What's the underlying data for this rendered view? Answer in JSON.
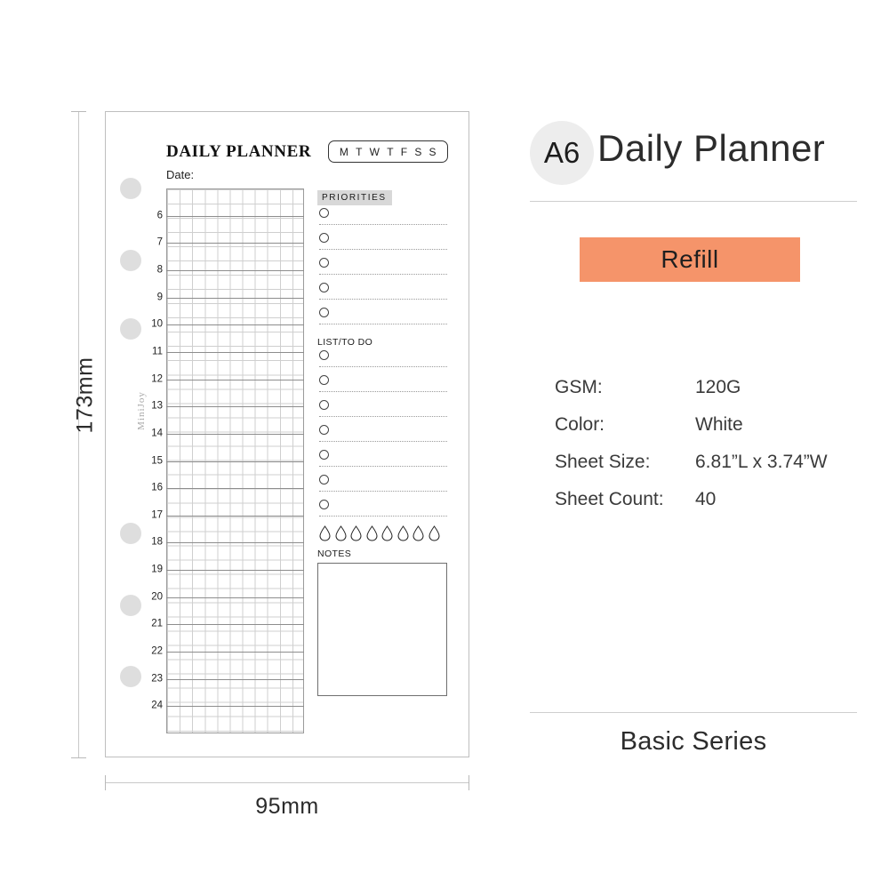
{
  "dimensions": {
    "height_label": "173mm",
    "width_label": "95mm"
  },
  "planner": {
    "title": "DAILY PLANNER",
    "date_label": "Date:",
    "brand": "MiniJoy",
    "days_of_week": [
      "M",
      "T",
      "W",
      "T",
      "F",
      "S",
      "S"
    ],
    "hours": [
      "6",
      "7",
      "8",
      "9",
      "10",
      "11",
      "12",
      "13",
      "14",
      "15",
      "16",
      "17",
      "18",
      "19",
      "20",
      "21",
      "22",
      "23",
      "24"
    ],
    "priorities_heading": "PRIORITIES",
    "priorities_count": 5,
    "todo_heading": "LIST/TO DO",
    "todo_count": 7,
    "water_drops_count": 8,
    "notes_heading": "NOTES",
    "punch_holes_count": 6,
    "grid_columns": 11,
    "grid_rows": 38
  },
  "info": {
    "size_badge": "A6",
    "title": "Daily Planner",
    "refill_label": "Refill",
    "series_label": "Basic Series",
    "specs": [
      {
        "key": "GSM:",
        "value": "120G"
      },
      {
        "key": "Color:",
        "value": "White"
      },
      {
        "key": "Sheet Size:",
        "value": "6.81”L x 3.74”W"
      },
      {
        "key": "Sheet Count:",
        "value": "40"
      }
    ]
  },
  "colors": {
    "accent_orange": "#f5946a",
    "badge_gray": "#ededed",
    "heading_shade": "#d8d8d8",
    "hole_gray": "#dedede"
  }
}
